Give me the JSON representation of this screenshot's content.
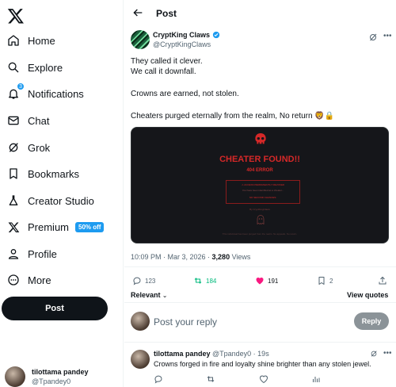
{
  "nav": {
    "items": [
      {
        "label": "Home",
        "icon": "home-icon"
      },
      {
        "label": "Explore",
        "icon": "search-icon"
      },
      {
        "label": "Notifications",
        "icon": "bell-icon",
        "badge": "3"
      },
      {
        "label": "Chat",
        "icon": "mail-icon"
      },
      {
        "label": "Grok",
        "icon": "grok-icon"
      },
      {
        "label": "Bookmarks",
        "icon": "bookmark-icon"
      },
      {
        "label": "Creator Studio",
        "icon": "creator-studio-icon"
      },
      {
        "label": "Premium",
        "icon": "x-logo-icon",
        "badge_text": "50% off"
      },
      {
        "label": "Profile",
        "icon": "person-icon"
      },
      {
        "label": "More",
        "icon": "more-circle-icon"
      }
    ],
    "post_button": "Post"
  },
  "account": {
    "name": "tilottama pandey",
    "handle": "@Tpandey0"
  },
  "header": {
    "title": "Post"
  },
  "post": {
    "author_name": "CryptKing Claws",
    "author_handle": "@CryptKingClaws",
    "lines": [
      "They called it clever.",
      "We call it downfall.",
      "Crowns are earned, not stolen.",
      "Cheaters purged eternally from the realm, No return 🦁🔒"
    ],
    "media": {
      "headline": "CHEATER FOUND!!",
      "code": "404 ERROR",
      "box_line1": "⚠ ACCESS PERMANENTLY REVOKED",
      "box_line2": "You have been identified as a cheater...",
      "box_line3": "NO SECOND CHANCES.",
      "caption1": "By CryptKingClaws",
      "caption2": "This individual has been purged from the realm. No appeals. No return."
    },
    "meta_time": "10:09 PM · Mar 3, 2026 · ",
    "meta_views": "3,280",
    "meta_views_label": " Views",
    "stats": {
      "replies": "123",
      "reposts": "184",
      "likes": "191",
      "bookmarks": "2"
    },
    "accent": "#1d9bf0",
    "like_color": "#f91880",
    "repost_color": "#00ba7c"
  },
  "sort": {
    "label": "Relevant",
    "view_quotes": "View quotes"
  },
  "reply": {
    "placeholder": "Post your reply",
    "button": "Reply"
  },
  "comment": {
    "name": "tilottama pandey",
    "handle_time": " @Tpandey0 · 19s",
    "text": "Crowns forged in fire and loyalty shine brighter than any stolen jewel."
  }
}
